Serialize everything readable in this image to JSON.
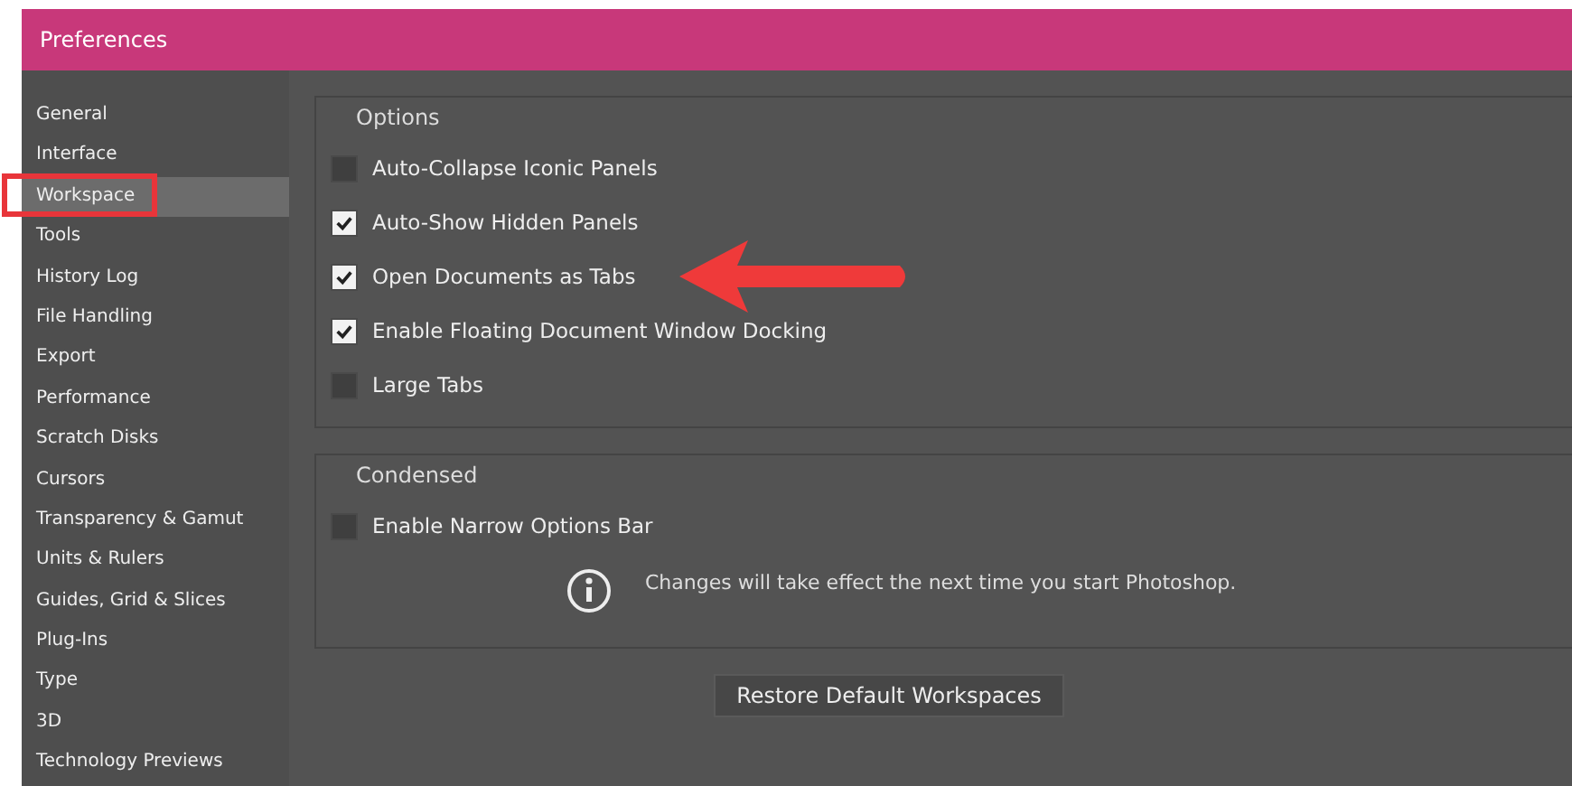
{
  "window": {
    "title": "Preferences"
  },
  "sidebar": {
    "items": [
      {
        "label": "General",
        "selected": false,
        "highlighted": false
      },
      {
        "label": "Interface",
        "selected": false,
        "highlighted": false
      },
      {
        "label": "Workspace",
        "selected": true,
        "highlighted": true
      },
      {
        "label": "Tools",
        "selected": false,
        "highlighted": false
      },
      {
        "label": "History Log",
        "selected": false,
        "highlighted": false
      },
      {
        "label": "File Handling",
        "selected": false,
        "highlighted": false
      },
      {
        "label": "Export",
        "selected": false,
        "highlighted": false
      },
      {
        "label": "Performance",
        "selected": false,
        "highlighted": false
      },
      {
        "label": "Scratch Disks",
        "selected": false,
        "highlighted": false
      },
      {
        "label": "Cursors",
        "selected": false,
        "highlighted": false
      },
      {
        "label": "Transparency & Gamut",
        "selected": false,
        "highlighted": false
      },
      {
        "label": "Units & Rulers",
        "selected": false,
        "highlighted": false
      },
      {
        "label": "Guides, Grid & Slices",
        "selected": false,
        "highlighted": false
      },
      {
        "label": "Plug-Ins",
        "selected": false,
        "highlighted": false
      },
      {
        "label": "Type",
        "selected": false,
        "highlighted": false
      },
      {
        "label": "3D",
        "selected": false,
        "highlighted": false
      },
      {
        "label": "Technology Previews",
        "selected": false,
        "highlighted": false
      }
    ]
  },
  "groups": [
    {
      "title": "Options",
      "options": [
        {
          "label": "Auto-Collapse Iconic Panels",
          "checked": false,
          "pointed": false
        },
        {
          "label": "Auto-Show Hidden Panels",
          "checked": true,
          "pointed": false
        },
        {
          "label": "Open Documents as Tabs",
          "checked": true,
          "pointed": true
        },
        {
          "label": "Enable Floating Document Window Docking",
          "checked": true,
          "pointed": false
        },
        {
          "label": "Large Tabs",
          "checked": false,
          "pointed": false
        }
      ]
    },
    {
      "title": "Condensed",
      "options": [
        {
          "label": "Enable Narrow Options Bar",
          "checked": false,
          "pointed": false
        }
      ],
      "note": "Changes will take effect the next time you start Photoshop."
    }
  ],
  "buttons": [
    "Restore Default Workspaces"
  ]
}
